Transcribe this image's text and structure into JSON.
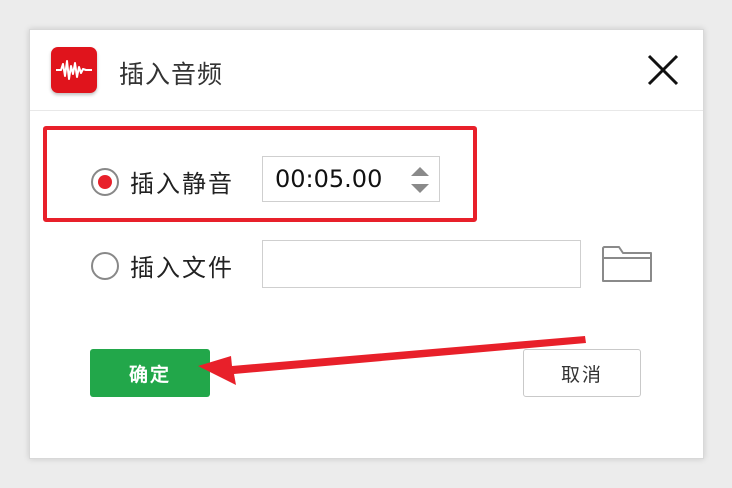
{
  "dialog": {
    "title": "插入音频",
    "app_icon": "audio-waveform-icon",
    "close_icon": "close-icon"
  },
  "options": {
    "silence": {
      "label": "插入静音",
      "selected": true,
      "duration": "00:05.00"
    },
    "file": {
      "label": "插入文件",
      "selected": false,
      "path": "",
      "browse_icon": "folder-icon"
    }
  },
  "buttons": {
    "ok": "确定",
    "cancel": "取消"
  },
  "colors": {
    "accent_red": "#e8202a",
    "ok_green": "#22a74a",
    "app_icon_red": "#e0141c"
  }
}
